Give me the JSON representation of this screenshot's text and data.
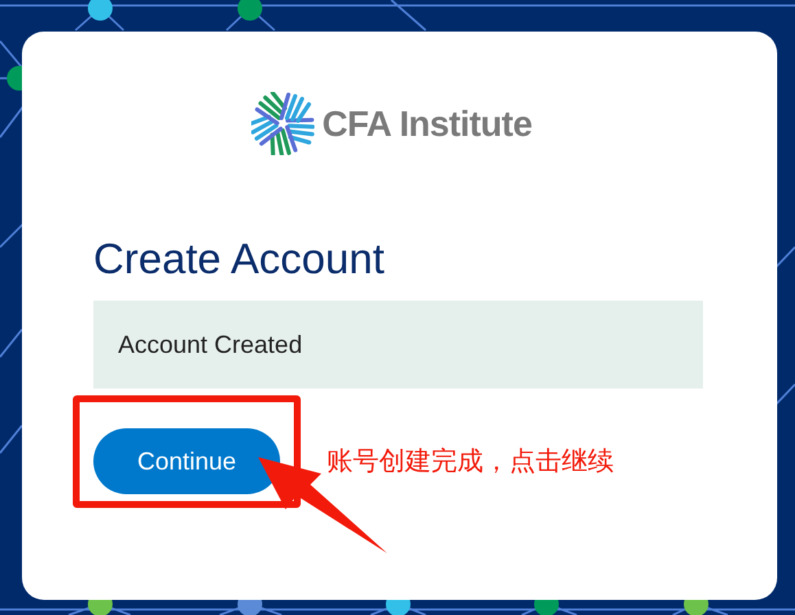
{
  "logo": {
    "text": "CFA Institute"
  },
  "heading": "Create Account",
  "message": "Account Created",
  "button": {
    "label": "Continue"
  },
  "annotation": {
    "text": "账号创建完成，点击继续"
  }
}
